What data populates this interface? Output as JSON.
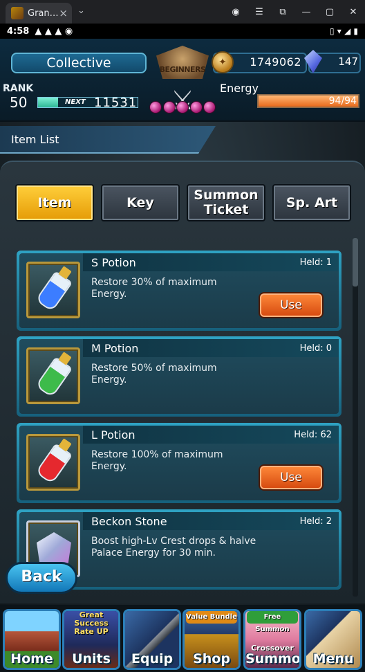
{
  "browser": {
    "tab_title": "Gran…",
    "tab_close": "×",
    "tab_dropdown": "⌄",
    "controls": [
      "◉",
      "☰",
      "⧉",
      "—",
      "▢",
      "✕"
    ]
  },
  "status_bar": {
    "time": "4:58",
    "left_icons": "▲ ▲ ▲ ◉",
    "right_icons": "▯ ▾ ◢ ▮"
  },
  "hud": {
    "player_name": "Collective",
    "rank_label": "RANK",
    "rank": "50",
    "next_label": "NEXT",
    "next_exp": "11531",
    "rank_progress": 0.2,
    "emblem_text": "BEGINNERS",
    "gold": "1749062",
    "gold_icon": "gold-coin",
    "gems": "147",
    "gem_icon": "crystal",
    "energy_label": "Energy",
    "energy_value": "94/94",
    "energy_fraction": 1.0
  },
  "section": {
    "title": "Item List"
  },
  "tabs": [
    {
      "label": "Item",
      "active": true
    },
    {
      "label": "Key",
      "active": false
    },
    {
      "label": "Summon Ticket",
      "active": false
    },
    {
      "label": "Sp. Art",
      "active": false
    }
  ],
  "items": [
    {
      "name": "S Potion",
      "held": "Held: 1",
      "desc": "Restore 30% of maximum Energy.",
      "use_label": "Use",
      "has_use": true,
      "icon": "blue-potion",
      "color": "#3c7dff"
    },
    {
      "name": "M Potion",
      "held": "Held: 0",
      "desc": "Restore 50% of maximum Energy.",
      "use_label": "",
      "has_use": false,
      "icon": "green-potion",
      "color": "#3dbb4a"
    },
    {
      "name": "L Potion",
      "held": "Held: 62",
      "desc": "Restore 100% of maximum Energy.",
      "use_label": "Use",
      "has_use": true,
      "icon": "red-potion",
      "color": "#e5282e"
    },
    {
      "name": "Beckon Stone",
      "held": "Held: 2",
      "desc": "Boost high-Lv Crest drops & halve Palace Energy for 30 min.",
      "use_label": "",
      "has_use": false,
      "icon": "crystal-stone",
      "color": "#b9c6f0"
    }
  ],
  "back_label": "Back",
  "nav": [
    {
      "label": "Home",
      "badge": "",
      "sub": "",
      "icon": "house"
    },
    {
      "label": "Units",
      "badge": "",
      "sub": "Great Success Rate UP",
      "icon": "hero"
    },
    {
      "label": "Equip",
      "badge": "",
      "sub": "",
      "icon": "sword"
    },
    {
      "label": "Shop",
      "badge": "Value Bundle",
      "sub": "",
      "icon": "treasure-chest"
    },
    {
      "label": "Summon",
      "badge": "Free Summon",
      "sub": "Crossover",
      "icon": "summon-portrait"
    },
    {
      "label": "Menu",
      "badge": "",
      "sub": "",
      "icon": "book"
    }
  ]
}
